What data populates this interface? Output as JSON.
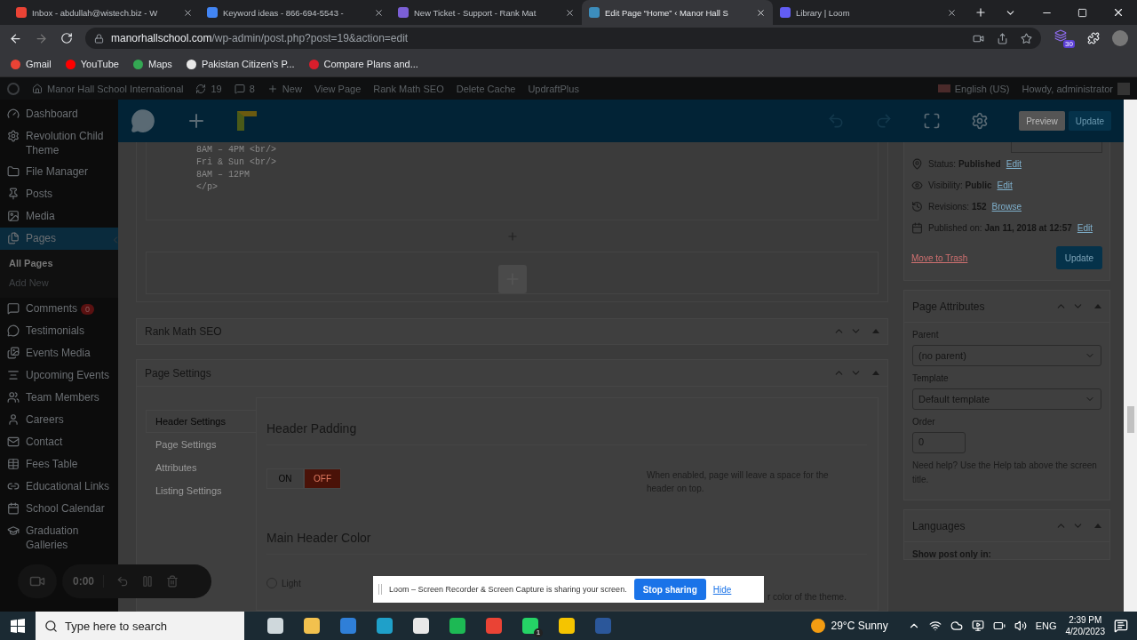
{
  "browser": {
    "tabs": [
      {
        "title": "Inbox - abdullah@wistech.biz - W",
        "selected": false,
        "color": "#ea4335"
      },
      {
        "title": "Keyword ideas - 866-694-5543 -",
        "selected": false,
        "color": "#4285f4"
      },
      {
        "title": "New Ticket - Support - Rank Mat",
        "selected": false,
        "color": "#7b5fd6"
      },
      {
        "title": "Edit Page “Home” ‹ Manor Hall S",
        "selected": true,
        "color": "#3c8dbc"
      },
      {
        "title": "Library | Loom",
        "selected": false,
        "color": "#625df5"
      }
    ],
    "url_host": "manorhallschool.com",
    "url_path": "/wp-admin/post.php?post=19&action=edit",
    "extension_badge": "30",
    "bookmarks": [
      {
        "label": "Gmail",
        "color": "#ea4335"
      },
      {
        "label": "YouTube",
        "color": "#ff0000"
      },
      {
        "label": "Maps",
        "color": "#34a853"
      },
      {
        "label": "Pakistan Citizen's P...",
        "color": "#e8e8e8"
      },
      {
        "label": "Compare Plans and...",
        "color": "#d81e2c"
      }
    ]
  },
  "admin_bar": {
    "site": "Manor Hall School International",
    "updates": "19",
    "comments": "8",
    "new": "New",
    "items": [
      "View Page",
      "Rank Math SEO",
      "Delete Cache",
      "UpdraftPlus"
    ],
    "language": "English (US)",
    "greeting": "Howdy, administrator"
  },
  "sidebar": {
    "items": [
      {
        "label": "Dashboard",
        "selected": false
      },
      {
        "label": "Revolution Child Theme",
        "selected": false
      },
      {
        "label": "File Manager",
        "selected": false
      },
      {
        "label": "Posts",
        "selected": false
      },
      {
        "label": "Media",
        "selected": false
      },
      {
        "label": "Pages",
        "selected": true,
        "children": [
          {
            "label": "All Pages",
            "selected": true
          },
          {
            "label": "Add New",
            "selected": false
          }
        ]
      },
      {
        "label": "Comments",
        "selected": false,
        "badge": "0"
      },
      {
        "label": "Testimonials",
        "selected": false
      },
      {
        "label": "Events Media",
        "selected": false
      },
      {
        "label": "Upcoming Events",
        "selected": false
      },
      {
        "label": "Team Members",
        "selected": false
      },
      {
        "label": "Careers",
        "selected": false
      },
      {
        "label": "Contact",
        "selected": false
      },
      {
        "label": "Fees Table",
        "selected": false
      },
      {
        "label": "Educational Links",
        "selected": false
      },
      {
        "label": "School Calendar",
        "selected": false
      },
      {
        "label": "Graduation Galleries",
        "selected": false
      }
    ]
  },
  "editor_toolbar": {
    "preview": "Preview",
    "update": "Update"
  },
  "code_lines": [
    "8AM – 4PM <br/>",
    "Fri & Sun <br/>",
    "8AM – 12PM",
    "</p>"
  ],
  "panels": [
    {
      "title": "Rank Math SEO"
    },
    {
      "title": "Page Settings"
    }
  ],
  "page_settings": {
    "tabs": [
      {
        "label": "Header Settings",
        "selected": true
      },
      {
        "label": "Page Settings",
        "selected": false
      },
      {
        "label": "Attributes",
        "selected": false
      },
      {
        "label": "Listing Settings",
        "selected": false
      }
    ],
    "header_padding": {
      "title": "Header Padding",
      "options": [
        {
          "label": "ON",
          "selected": false
        },
        {
          "label": "OFF",
          "selected": true
        }
      ],
      "description": "When enabled, page will leave a space for the header on top."
    },
    "main_header_color": {
      "title": "Main Header Color",
      "options": [
        {
          "label": "Light",
          "checked": false
        }
      ],
      "description": "r color of the theme."
    }
  },
  "publish": {
    "rows": [
      {
        "label": "Status:",
        "value": "Published",
        "link": "Edit"
      },
      {
        "label": "Visibility:",
        "value": "Public",
        "link": "Edit"
      },
      {
        "label": "Revisions:",
        "value": "152",
        "link": "Browse"
      },
      {
        "label": "Published on:",
        "value": "Jan 11, 2018 at 12:57",
        "link": "Edit"
      }
    ],
    "trash": "Move to Trash",
    "update": "Update"
  },
  "page_attributes": {
    "title": "Page Attributes",
    "parent_label": "Parent",
    "parent_value": "(no parent)",
    "template_label": "Template",
    "template_value": "Default template",
    "order_label": "Order",
    "order_value": "0",
    "help": "Need help? Use the Help tab above the screen title."
  },
  "languages": {
    "title": "Languages",
    "show_label": "Show post only in:"
  },
  "recorder": {
    "time": "0:00"
  },
  "loom": {
    "message": "Loom – Screen Recorder & Screen Capture is sharing your screen.",
    "stop": "Stop sharing",
    "hide": "Hide"
  },
  "taskbar": {
    "search_placeholder": "Type here to search",
    "weather": "29°C  Sunny",
    "language": "ENG",
    "time": "2:39 PM",
    "date": "4/20/2023",
    "whatsapp_badge": "1"
  }
}
